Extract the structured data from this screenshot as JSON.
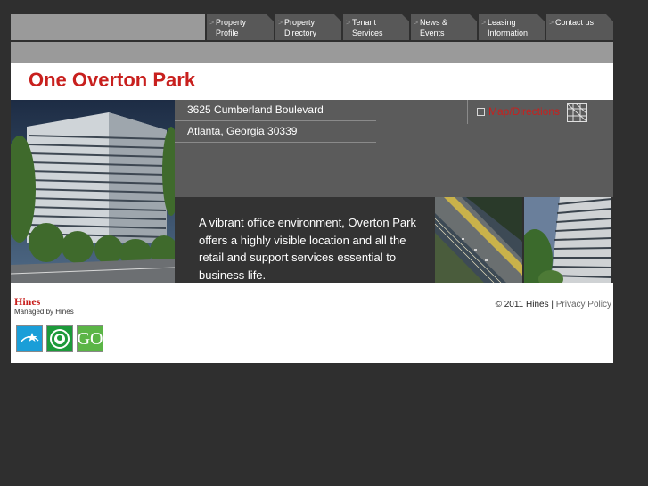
{
  "nav": {
    "tabs": [
      {
        "label": "Property Profile"
      },
      {
        "label": "Property Directory"
      },
      {
        "label": "Tenant Services"
      },
      {
        "label": "News & Events"
      },
      {
        "label": "Leasing Information"
      },
      {
        "label": "Contact us"
      }
    ],
    "arrow_glyph": ">"
  },
  "property": {
    "title": "One Overton Park",
    "address_line1": "3625 Cumberland Boulevard",
    "address_line2": "Atlanta, Georgia 30339",
    "map_link": "Map/Directions",
    "description": "A vibrant office environment, Overton Park offers a highly visible location and all the retail and support services essential to business life."
  },
  "footer": {
    "logo_text": "Hines",
    "managed_by": "Managed by Hines",
    "copyright": "© 2011 Hines |",
    "privacy_link": "Privacy Policy",
    "go_badge": "GO"
  },
  "colors": {
    "accent_red": "#c8201e",
    "page_bg": "#2f2f2f",
    "nav_tab": "#585858",
    "band_gray": "#9a9a9a"
  }
}
